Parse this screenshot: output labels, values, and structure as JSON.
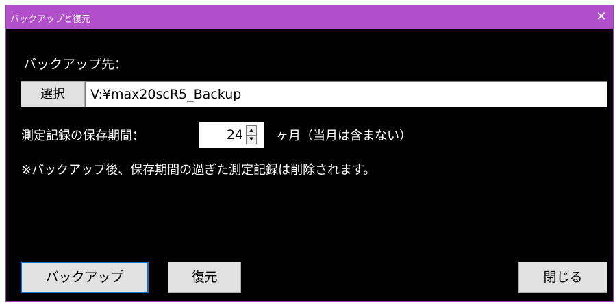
{
  "window": {
    "title": "バックアップと復元",
    "close_glyph": "✕"
  },
  "backup_dest": {
    "label": "バックアップ先：",
    "select_label": "選択",
    "path_value": "V:¥max20scR5_Backup"
  },
  "retention": {
    "label": "測定記録の保存期間：",
    "value": "24",
    "unit_label": "ヶ月（当月は含まない）"
  },
  "note": "※バックアップ後、保存期間の過ぎた測定記録は削除されます。",
  "buttons": {
    "backup": "バックアップ",
    "restore": "復元",
    "close": "閉じる"
  },
  "colors": {
    "titlebar": "#b04fc9",
    "background": "#000000",
    "focus_border": "#0078d7"
  }
}
